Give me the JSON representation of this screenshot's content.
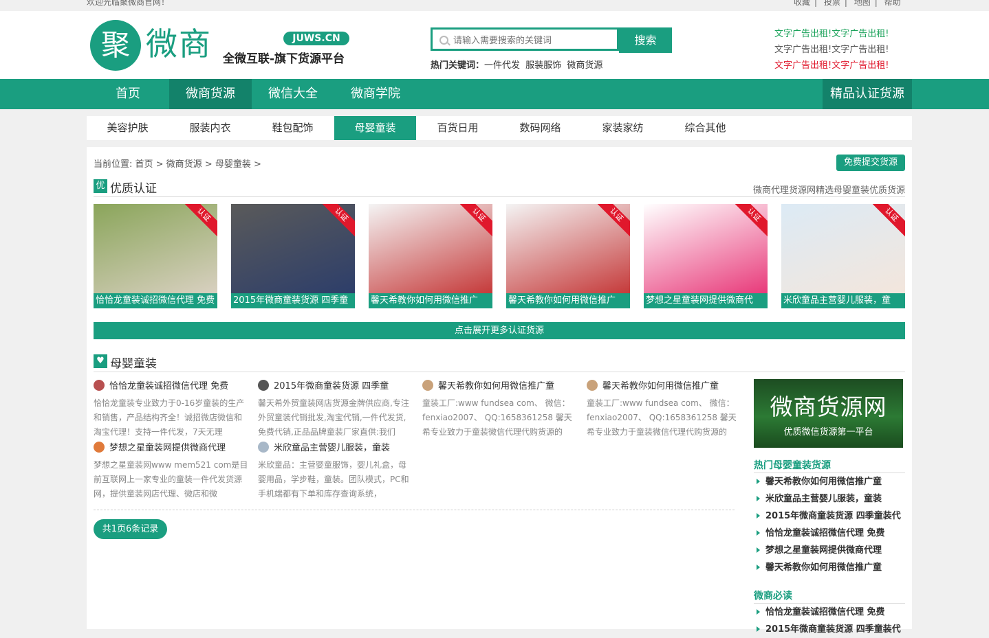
{
  "topbar": {
    "welcome": "欢迎光临聚微商官网！",
    "links": [
      "收藏",
      "投票",
      "地图",
      "帮助"
    ]
  },
  "header": {
    "logo_char": "聚",
    "logo_name": "微商",
    "logo_domain": "JUWS.CN",
    "slogan": "全微互联-旗下货源平台",
    "search_placeholder": "请输入需要搜索的关键词",
    "search_button": "搜索",
    "hot_label": "热门关键词：",
    "hot_keywords": [
      "一件代发",
      "服装服饰",
      "微商货源"
    ],
    "ads": [
      {
        "text": "文字广告出租!文字广告出租!",
        "color": "#1aa25a"
      },
      {
        "text": "文字广告出租!文字广告出租!",
        "color": "#555555"
      },
      {
        "text": "文字广告出租!文字广告出租!",
        "color": "#e0182c"
      }
    ]
  },
  "main_nav": {
    "items": [
      "首页",
      "微商货源",
      "微信大全",
      "微商学院"
    ],
    "active": "微商货源",
    "right_item": "精品认证货源"
  },
  "sub_nav": {
    "items": [
      "美容护肤",
      "服装内衣",
      "鞋包配饰",
      "母婴童装",
      "百货日用",
      "数码网络",
      "家装家纺",
      "综合其他"
    ],
    "active": "母婴童装"
  },
  "breadcrumb": "当前位置: 首页 > 微商货源 > 母婴童装 >",
  "submit_button": "免费提交货源",
  "featured": {
    "icon_char": "优",
    "title": "优质认证",
    "description": "微商代理货源网精选母婴童装优质货源",
    "ribbon": "认证",
    "cards": [
      {
        "caption": "恰恰龙童装诚招微信代理 免费",
        "colors": [
          "#8aa55a",
          "#d8d0c0"
        ]
      },
      {
        "caption": "2015年微商童装货源 四季童",
        "colors": [
          "#5a5a5a",
          "#2d3e6a"
        ]
      },
      {
        "caption": "馨天希教你如何用微信推广",
        "colors": [
          "#f4f4f4",
          "#c53a3a"
        ]
      },
      {
        "caption": "馨天希教你如何用微信推广",
        "colors": [
          "#f4f4f4",
          "#c53a3a"
        ]
      },
      {
        "caption": "梦想之星童装网提供微商代",
        "colors": [
          "#ffffff",
          "#e83a7a"
        ]
      },
      {
        "caption": "米欣童品主营婴儿服装，童",
        "colors": [
          "#dceaf5",
          "#f3e6dc"
        ]
      }
    ],
    "more_bar": "点击展开更多认证货源"
  },
  "category": {
    "title": "母婴童装",
    "items": [
      {
        "title": "恰恰龙童装诚招微信代理 免费",
        "desc": "恰恰龙童装专业致力于0-16岁童装的生产和销售，产品结构齐全！诚招微店微信和淘宝代理！支持一件代发，7天无理",
        "avatar": "#b85050"
      },
      {
        "title": "2015年微商童装货源 四季童",
        "desc": "馨天希外贸童装网店货源金牌供应商,专注外贸童装代销批发,淘宝代销,一件代发货,免费代销,正品品牌童装厂家直供:我们",
        "avatar": "#555555"
      },
      {
        "title": "馨天希教你如何用微信推广童",
        "desc": "童装工厂:www fundsea com、 微信：fenxiao2007、 QQ:1658361258 馨天希专业致力于童装微信代理代购货源的",
        "avatar": "#c9a27a"
      },
      {
        "title": "馨天希教你如何用微信推广童",
        "desc": "童装工厂:www fundsea com、 微信：fenxiao2007、 QQ:1658361258 馨天希专业致力于童装微信代理代购货源的",
        "avatar": "#c9a27a"
      },
      {
        "title": "梦想之星童装网提供微商代理",
        "desc": "梦想之星童装网www mem521 com是目前互联网上一家专业的童装一件代发货源网，提供童装网店代理、微店和微",
        "avatar": "#e07a3a"
      },
      {
        "title": "米欣童品主营婴儿服装，童装",
        "desc": "米欣童品：主营婴童服饰，婴儿礼盒，母婴用品，学步鞋，童装。团队模式，PC和手机端都有下单和库存查询系统，",
        "avatar": "#a8b8c8"
      }
    ],
    "pager": "共1页6条记录"
  },
  "sidebar": {
    "banner_big": "微商货源网",
    "banner_small": "优质微信货源第一平台",
    "hot_title": "热门母婴童装货源",
    "hot_items": [
      "馨天希教你如何用微信推广童",
      "米欣童品主营婴儿服装，童装",
      "2015年微商童装货源 四季童装代",
      "恰恰龙童装诚招微信代理 免费",
      "梦想之星童装网提供微商代理",
      "馨天希教你如何用微信推广童"
    ],
    "must_read_title": "微商必读",
    "must_read_items": [
      "恰恰龙童装诚招微信代理 免费",
      "2015年微商童装货源 四季童装代"
    ]
  }
}
